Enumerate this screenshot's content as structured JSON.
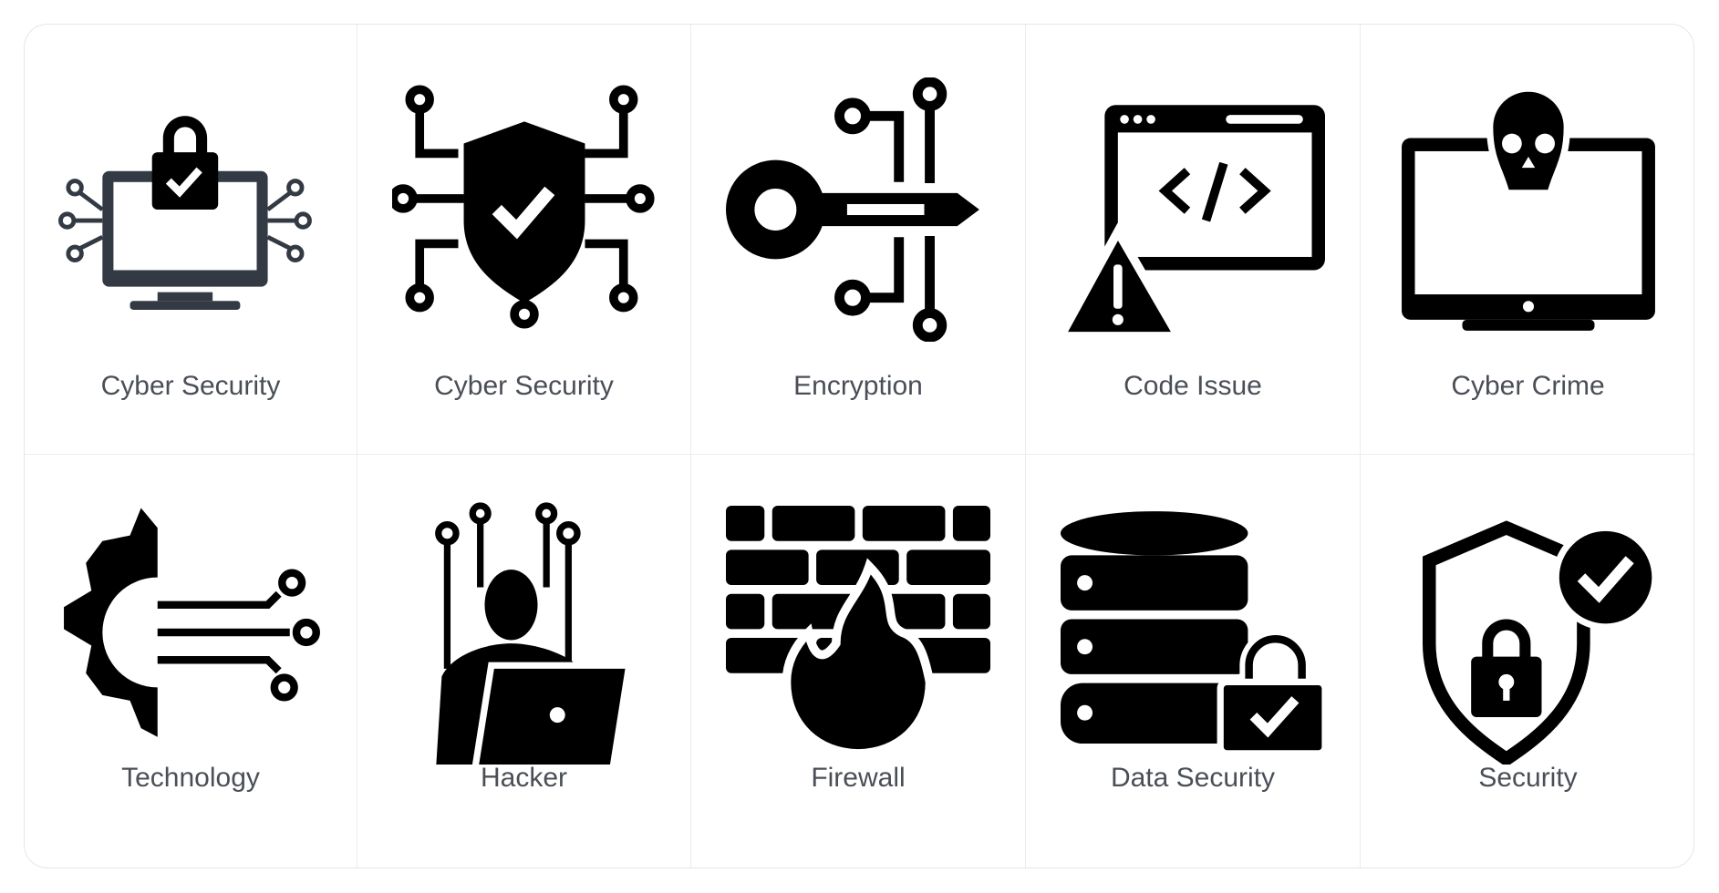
{
  "icons": [
    {
      "label": "Cyber Security",
      "icon": "monitor-lock-circuit-icon"
    },
    {
      "label": "Cyber Security",
      "icon": "shield-check-circuit-icon"
    },
    {
      "label": "Encryption",
      "icon": "key-circuit-icon"
    },
    {
      "label": "Code Issue",
      "icon": "browser-code-warning-icon"
    },
    {
      "label": "Cyber Crime",
      "icon": "monitor-skull-icon"
    },
    {
      "label": "Technology",
      "icon": "gear-circuit-icon"
    },
    {
      "label": "Hacker",
      "icon": "hacker-laptop-icon"
    },
    {
      "label": "Firewall",
      "icon": "brick-wall-fire-icon"
    },
    {
      "label": "Data Security",
      "icon": "database-lock-icon"
    },
    {
      "label": "Security",
      "icon": "shield-lock-check-icon"
    }
  ],
  "colors": {
    "icon": "#000000",
    "icon_alt": "#333a44",
    "label": "#4a4f57",
    "border": "#e6e6e6"
  }
}
